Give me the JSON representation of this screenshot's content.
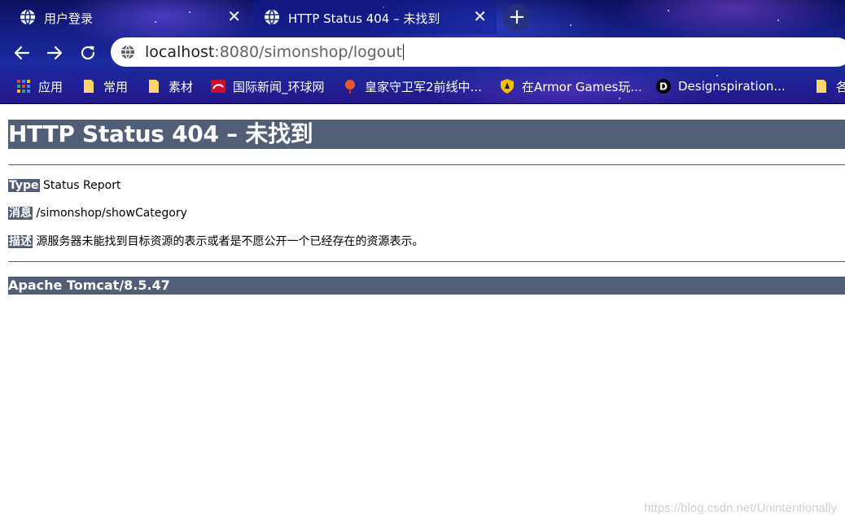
{
  "browser": {
    "tabs": [
      {
        "title": "用户登录",
        "active": false
      },
      {
        "title": "HTTP Status 404 – 未找到",
        "active": true
      }
    ],
    "new_tab_label": "+",
    "close_label": "✕",
    "address": {
      "host": "localhost",
      "rest": ":8080/simonshop/logout"
    },
    "bookmarks": [
      {
        "label": "应用",
        "icon": "apps-grid-icon"
      },
      {
        "label": "常用",
        "icon": "folder-icon"
      },
      {
        "label": "素材",
        "icon": "folder-icon"
      },
      {
        "label": "国际新闻_环球网",
        "icon": "site-favicon"
      },
      {
        "label": "皇家守卫军2前线中...",
        "icon": "game-favicon"
      },
      {
        "label": "在Armor Games玩...",
        "icon": "shield-favicon"
      },
      {
        "label": "Designspiration...",
        "icon": "d-favicon"
      },
      {
        "label": "各",
        "icon": "folder-icon"
      }
    ]
  },
  "page": {
    "heading": "HTTP Status 404 – 未找到",
    "type_label": "Type",
    "type_value": "Status Report",
    "message_label": "消息",
    "message_value": "/simonshop/showCategory",
    "description_label": "描述",
    "description_value": "源服务器未能找到目标资源的表示或者是不愿公开一个已经存在的资源表示。",
    "server": "Apache Tomcat/8.5.47"
  },
  "watermark": "https://blog.csdn.net/Unintentionally",
  "colors": {
    "tomcat_banner": "#525d76",
    "chrome_bg": "#16208a"
  }
}
